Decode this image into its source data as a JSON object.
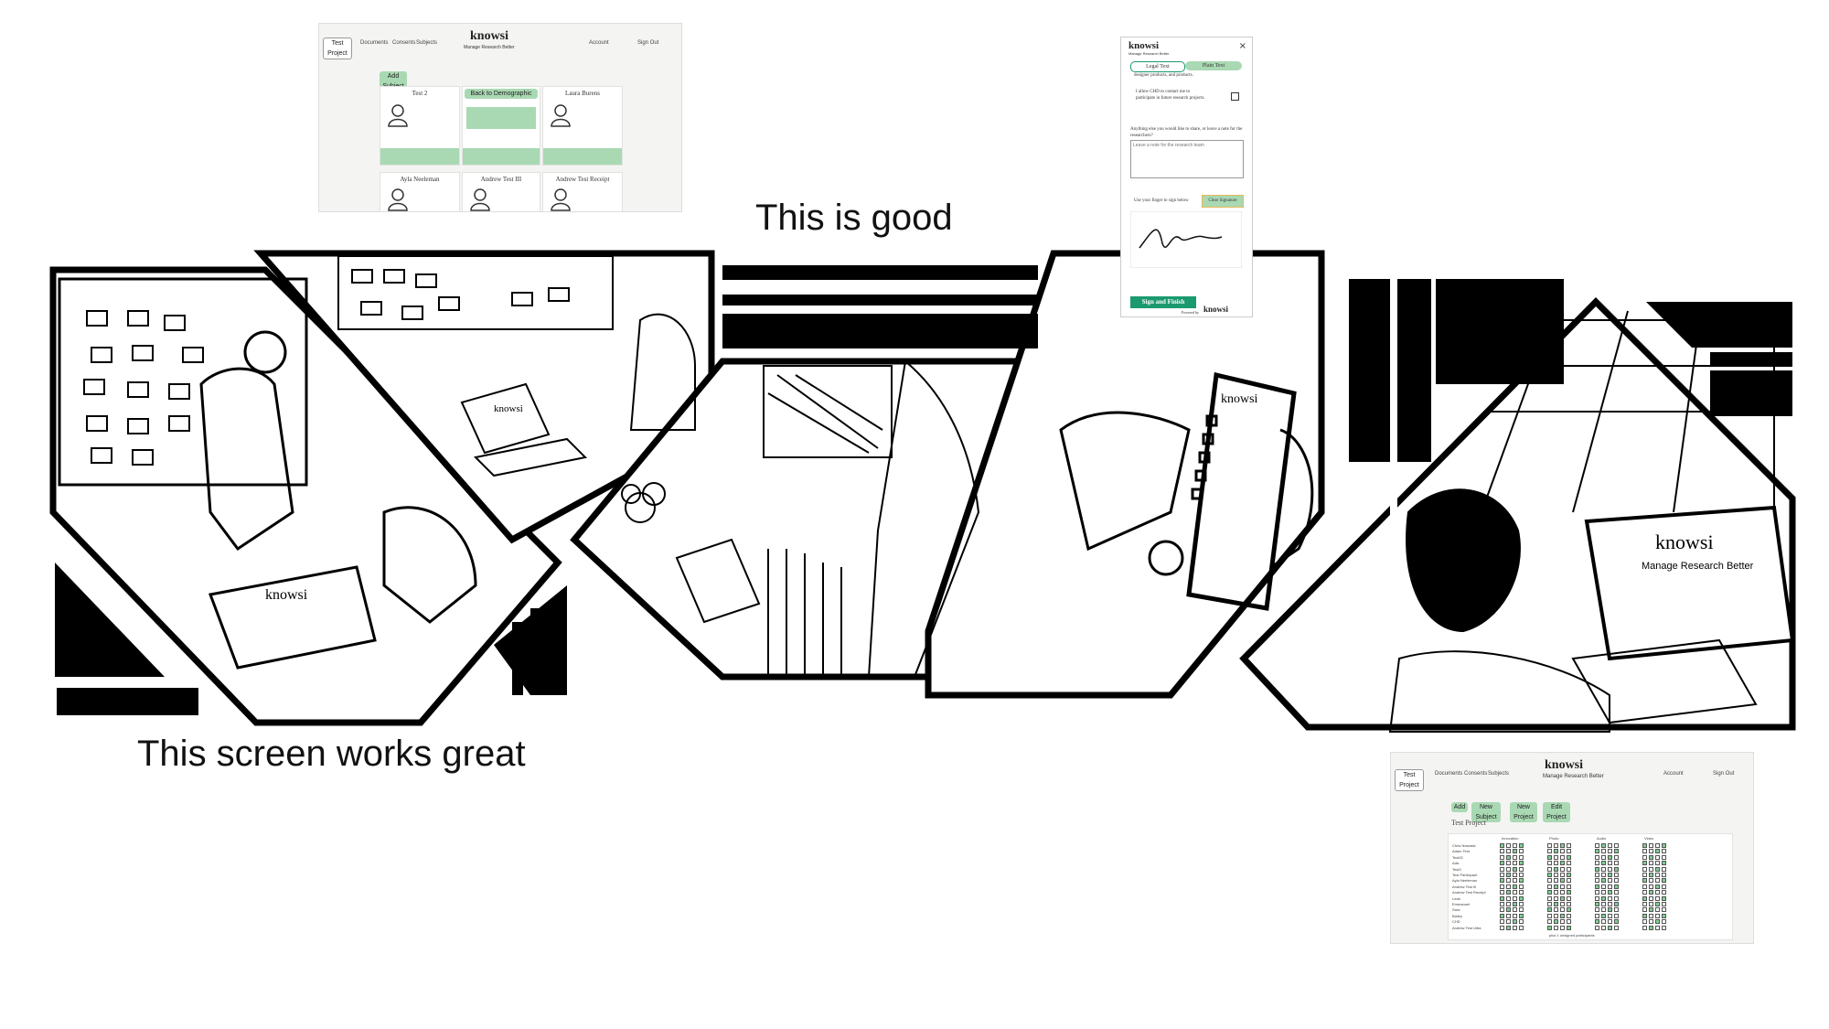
{
  "captions": {
    "top_middle": "This is good",
    "bottom_left": "This screen works great"
  },
  "brand": {
    "name": "knowsi",
    "tagline": "Manage Research Better",
    "accent": "#a9d9b3",
    "accent_dark": "#1a9a6e"
  },
  "dashboard_screen": {
    "nav": {
      "project_button": "Test Project",
      "links": [
        "Documents",
        "Consents",
        "Subjects"
      ],
      "account": "Account",
      "signout": "Sign Out"
    },
    "add_button": "Add Subject",
    "center_button": "Back to Demographic",
    "cards": [
      {
        "name": "Test 2"
      },
      {
        "name": "Laura Burens"
      },
      {
        "name": "Ayla Neeleman"
      },
      {
        "name": "Andrew Test III"
      },
      {
        "name": "Andrew Test Receipt"
      }
    ]
  },
  "consent_modal": {
    "tabs": [
      "Legal Text",
      "Plain Text"
    ],
    "close_symbol": "×",
    "fragment_top": "designer products, and products.",
    "checkbox_text": "I allow CHD to contact me to participate in future research projects.",
    "note_label": "Anything else you would like to share, or leave a note for the researchers?",
    "note_placeholder": "Leave a note for the research team",
    "sign_label": "Use your finger to sign below",
    "clear_button": "Clear Signature",
    "sign_finish": "Sign and Finish",
    "powered_by": "Powered by"
  },
  "matrix_screen": {
    "nav": {
      "project_button": "Test Project",
      "links": [
        "Documents",
        "Consents",
        "Subjects"
      ],
      "account": "Account",
      "signout": "Sign Out"
    },
    "buttons": [
      "Add",
      "New Subject",
      "New Project",
      "Edit Project"
    ],
    "title": "Test Project",
    "column_headers": [
      "Innovation",
      "Photo",
      "Audio",
      "Video"
    ],
    "rows": [
      "Chris Nowaski",
      "Adam Test",
      "Test02",
      "Ada",
      "Test3",
      "Test Participant",
      "Ayla Neeleman",
      "Andrew Test III",
      "Andrew Test Receipt",
      "Leah",
      "Emmanuel",
      "Sara",
      "Bailey",
      "CHD",
      "Andrew Test Ultra"
    ],
    "footer": "plus 1 unsigned participants"
  }
}
